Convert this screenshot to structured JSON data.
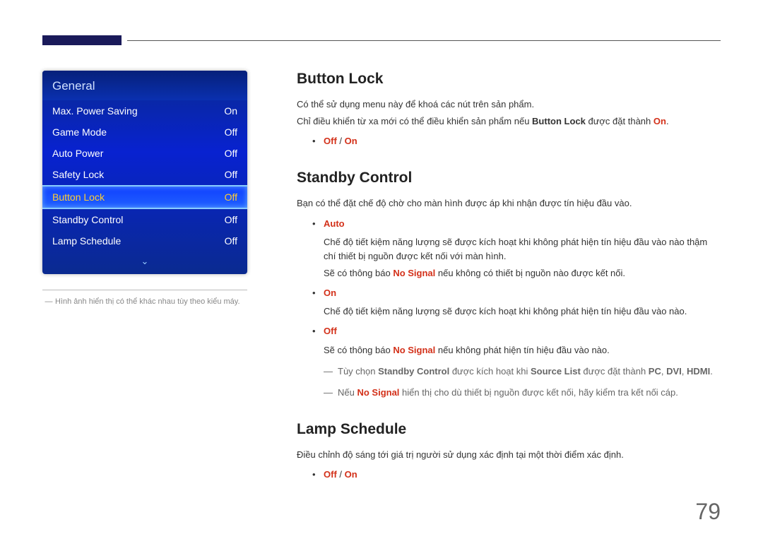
{
  "osd": {
    "title": "General",
    "rows": [
      {
        "label": "Max. Power Saving",
        "value": "On"
      },
      {
        "label": "Game Mode",
        "value": "Off"
      },
      {
        "label": "Auto Power",
        "value": "Off"
      },
      {
        "label": "Safety Lock",
        "value": "Off"
      },
      {
        "label": "Button Lock",
        "value": "Off",
        "selected": true
      },
      {
        "label": "Standby Control",
        "value": "Off"
      },
      {
        "label": "Lamp Schedule",
        "value": "Off"
      }
    ],
    "chevron": "⌄"
  },
  "caption": "Hình ảnh hiển thị có thể khác nhau tùy theo kiểu máy.",
  "buttonLock": {
    "heading": "Button Lock",
    "p1": "Có thể sử dụng menu này để khoá các nút trên sản phẩm.",
    "p2a": "Chỉ điều khiển từ xa mới có thể điều khiển sản phẩm nếu ",
    "p2b": "Button Lock",
    "p2c": " được đặt thành ",
    "p2d": "On",
    "p2e": ".",
    "opts_off": "Off",
    "opts_sep": " / ",
    "opts_on": "On"
  },
  "standby": {
    "heading": "Standby Control",
    "p1": "Bạn có thể đặt chế độ chờ cho màn hình được áp khi nhận được tín hiệu đầu vào.",
    "auto": "Auto",
    "auto_d1": "Chế độ tiết kiệm năng lượng sẽ được kích hoạt khi không phát hiện tín hiệu đầu vào nào thậm chí thiết bị nguồn được kết nối với màn hình.",
    "auto_d2a": "Sẽ có thông báo ",
    "auto_d2b": "No Signal",
    "auto_d2c": " nếu không có thiết bị nguồn nào được kết nối.",
    "on": "On",
    "on_d1": "Chế độ tiết kiệm năng lượng sẽ được kích hoạt khi không phát hiện tín hiệu đầu vào nào.",
    "off": "Off",
    "off_d1a": "Sẽ có thông báo ",
    "off_d1b": "No Signal",
    "off_d1c": " nếu không phát hiện tín hiệu đầu vào nào.",
    "note1a": "Tùy chọn ",
    "note1b": "Standby Control",
    "note1c": " được kích hoạt khi ",
    "note1d": "Source List",
    "note1e": " được đặt thành ",
    "note1f": "PC",
    "note1g": ", ",
    "note1h": "DVI",
    "note1i": ", ",
    "note1j": "HDMI",
    "note1k": ".",
    "note2a": "Nếu ",
    "note2b": "No Signal",
    "note2c": " hiển thị cho dù thiết bị nguồn được kết nối, hãy kiểm tra kết nối cáp."
  },
  "lamp": {
    "heading": "Lamp Schedule",
    "p1": "Điều chỉnh độ sáng tới giá trị người sử dụng xác định tại một thời điểm xác định.",
    "opts_off": "Off",
    "opts_sep": " / ",
    "opts_on": "On"
  },
  "pageNumber": "79"
}
